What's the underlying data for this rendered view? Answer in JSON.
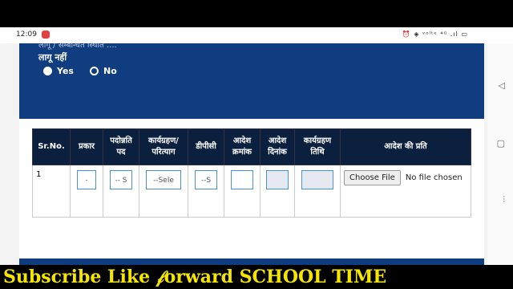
{
  "status_bar": {
    "time": "12:09",
    "icons_text": "⏰ ◈ ᵛᵒˡᵗᵉ ⁴ᴳ .ıl ▭"
  },
  "form": {
    "cut_text": "लागू / सम्बन्धित स्थिति ....",
    "question_label": "लागू नहीं",
    "options": [
      "Yes",
      "No"
    ],
    "selected_option": "Yes"
  },
  "table": {
    "headers": [
      "Sr.No.",
      "प्रकार",
      "पदोन्नति पद",
      "कार्यग्रहण/ परित्याग",
      "डीपीसी",
      "आदेश क्रमांक",
      "आदेश दिनांक",
      "कार्यग्रहण तिथि",
      "आदेश की प्रति"
    ],
    "row": {
      "sr_no": "1",
      "prakar": "-",
      "padonnati": "-- S",
      "karyagrahan": "--Sele",
      "dpc": "--S",
      "file_button": "Choose File",
      "file_status": "No file chosen"
    }
  },
  "banner": {
    "text": "Subscribe Like 𝒻orward SCHOOL TIME"
  },
  "nav": {
    "back": "◁",
    "home": "▢",
    "menu": "⫶"
  }
}
